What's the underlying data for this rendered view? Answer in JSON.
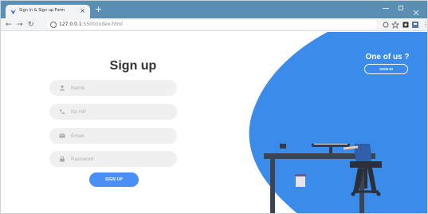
{
  "browser": {
    "tab_title": "Sign In & Sign up Form",
    "tab_close": "×",
    "new_tab": "+",
    "url_host": "127.0.0.1",
    "url_path": ":5500/index.html"
  },
  "form": {
    "title": "Sign up",
    "name_placeholder": "Name",
    "phone_placeholder": "No HP",
    "email_placeholder": "Email",
    "password_placeholder": "Password",
    "submit_label": "SIGN UP"
  },
  "side_panel": {
    "heading": "One of us ?",
    "signin_label": "SIGN IN"
  },
  "colors": {
    "accent": "#4a8ff5",
    "panel": "#3b8bea",
    "tabstrip": "#5a8fb3"
  }
}
